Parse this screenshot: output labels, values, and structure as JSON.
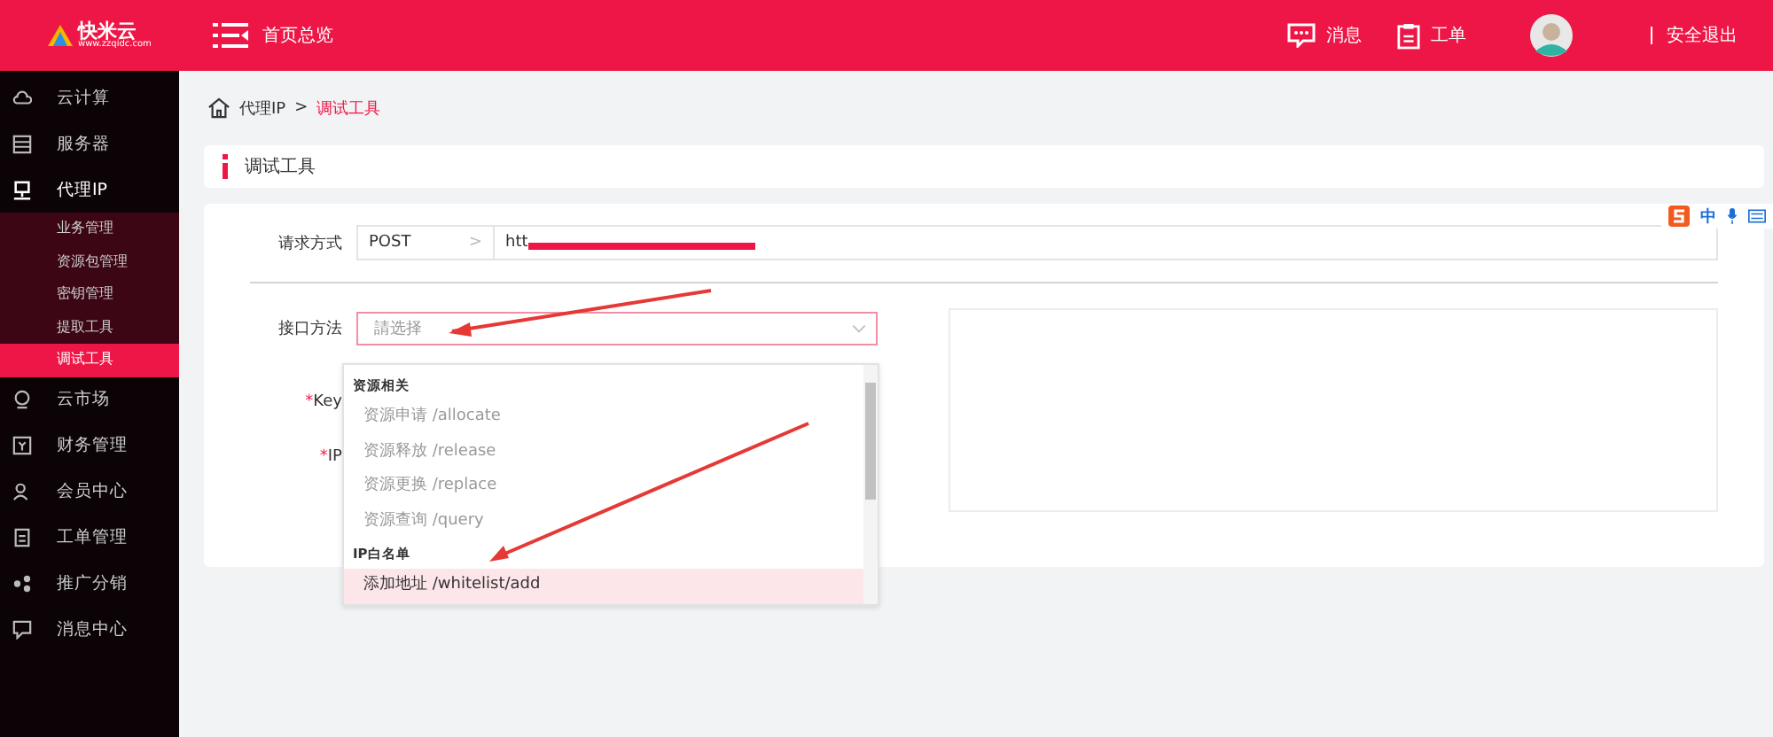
{
  "header": {
    "logo_text": "快米云",
    "logo_url": "www.zzqidc.com",
    "home_label": "首页总览",
    "actions": [
      {
        "kind": "message",
        "label": "消息"
      },
      {
        "kind": "ticket",
        "label": "工单"
      }
    ],
    "logout": "安全退出"
  },
  "sidebar": {
    "items": [
      {
        "kind": "cloud",
        "label": "云计算",
        "expanded": false
      },
      {
        "kind": "server",
        "label": "服务器",
        "expanded": false
      },
      {
        "kind": "monitor",
        "label": "代理IP",
        "expanded": true,
        "children": [
          {
            "label": "业务管理",
            "selected": false
          },
          {
            "label": "资源包管理",
            "selected": false
          },
          {
            "label": "密钥管理",
            "selected": false
          },
          {
            "label": "提取工具",
            "selected": false
          },
          {
            "label": "调试工具",
            "selected": true
          }
        ]
      },
      {
        "kind": "market",
        "label": "云市场",
        "expanded": false
      },
      {
        "kind": "finance",
        "label": "财务管理",
        "expanded": false
      },
      {
        "kind": "user",
        "label": "会员中心",
        "expanded": false
      },
      {
        "kind": "ticket",
        "label": "工单管理",
        "expanded": false
      },
      {
        "kind": "share",
        "label": "推广分销",
        "expanded": false
      },
      {
        "kind": "message",
        "label": "消息中心",
        "expanded": false
      }
    ]
  },
  "breadcrumb": [
    "代理IP",
    "调试工具"
  ],
  "breadcrumb_separator": ">",
  "page_title": "调试工具",
  "form": {
    "method_label": "请求方式",
    "method": "POST",
    "method_caret": ">",
    "url": "htt",
    "api_label": "接口方法",
    "api_placeholder": "請选择",
    "key_label": "Key",
    "ip_label": "IP",
    "required_mark": "*"
  },
  "dropdown": {
    "groups": [
      {
        "label": "资源相关",
        "options": [
          {
            "label": "资源申请 /allocate",
            "selected": false
          },
          {
            "label": "资源释放 /release",
            "selected": false
          },
          {
            "label": "资源更换 /replace",
            "selected": false
          },
          {
            "label": "资源查询 /query",
            "selected": false
          }
        ]
      },
      {
        "label": "IP白名单",
        "options": [
          {
            "label": "添加地址 /whitelist/add",
            "selected": true
          }
        ]
      }
    ]
  },
  "ime_toolbar": {
    "mode": "中"
  }
}
